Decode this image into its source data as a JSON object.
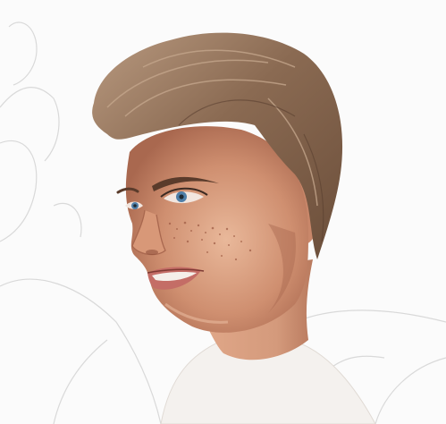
{
  "image": {
    "subject": "digital-painting-portrait",
    "colors": {
      "background": "#fbfbfb",
      "sketch_line": "#d9d9d9",
      "hair_dark": "#6b4e3a",
      "hair_mid": "#8a6a52",
      "hair_light": "#b99a80",
      "skin_light": "#e9b89a",
      "skin_mid": "#cf8f70",
      "skin_shadow": "#a9684f",
      "lips": "#c46d66",
      "eye_iris": "#4f7fa8",
      "eyebrow": "#5a3b2b",
      "freckles": "#9d5a43"
    }
  }
}
